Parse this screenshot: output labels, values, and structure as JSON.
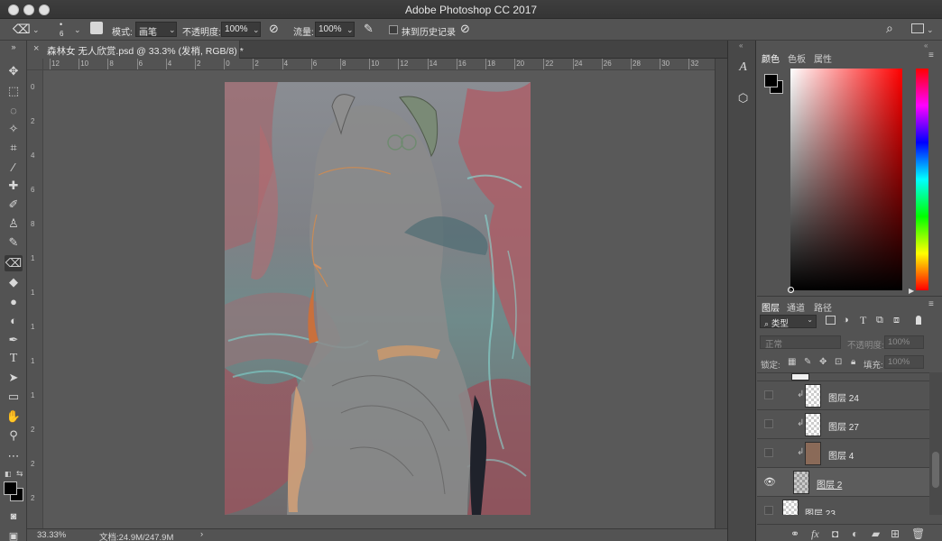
{
  "app": {
    "title": "Adobe Photoshop CC 2017"
  },
  "options": {
    "brush_size": "6",
    "mode_label": "模式:",
    "mode_value": "画笔",
    "opacity_label": "不透明度:",
    "opacity_value": "100%",
    "flow_label": "流量:",
    "flow_value": "100%",
    "history_label": "抹到历史记录"
  },
  "document": {
    "tab_label": "森林女 无人欣赏.psd @ 33.3% (发梢, RGB/8) *"
  },
  "rulers": {
    "top": [
      "12",
      "10",
      "8",
      "6",
      "4",
      "2",
      "0",
      "2",
      "4",
      "6",
      "8",
      "10",
      "12",
      "14",
      "16",
      "18",
      "20",
      "22",
      "24",
      "26",
      "28",
      "30",
      "32"
    ],
    "left": [
      "0",
      "2",
      "4",
      "6",
      "8",
      "1",
      "1",
      "1",
      "1",
      "1",
      "2",
      "2",
      "2"
    ]
  },
  "status": {
    "zoom": "33.33%",
    "doc_size": "文档:24.9M/247.9M"
  },
  "color_panel": {
    "tabs": [
      "颜色",
      "色板",
      "属性"
    ],
    "foreground": "#000000",
    "background": "#000000"
  },
  "layers_panel": {
    "tabs": [
      "图层",
      "通道",
      "路径"
    ],
    "filter_label": "类型",
    "blend_mode": "正常",
    "opacity_label": "不透明度:",
    "opacity_value": "100%",
    "lock_label": "锁定:",
    "fill_label": "填充:",
    "fill_value": "100%",
    "layers": [
      {
        "name": "图层 24",
        "visible": false,
        "clipped": true
      },
      {
        "name": "图层 27",
        "visible": false,
        "clipped": true
      },
      {
        "name": "图层 4",
        "visible": false,
        "clipped": true
      },
      {
        "name": "图层 2",
        "visible": true,
        "clipped": false
      },
      {
        "name": "图层 23",
        "visible": false,
        "clipped": false
      }
    ]
  },
  "colors": {
    "accent": "#ff0000",
    "canvas_bg": "#595959",
    "ui_dark": "#535353"
  }
}
